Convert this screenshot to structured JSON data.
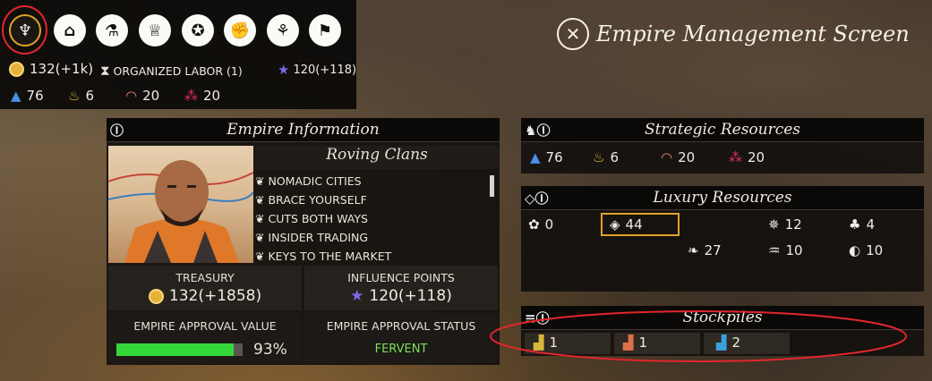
{
  "topbar": {
    "tabs": [
      {
        "name": "laurel-icon",
        "glyph": "♆",
        "active": true
      },
      {
        "name": "capitol-icon",
        "glyph": "⌂"
      },
      {
        "name": "flask-icon",
        "glyph": "⚗"
      },
      {
        "name": "trophy-icon",
        "glyph": "♕"
      },
      {
        "name": "medal-icon",
        "glyph": "✪"
      },
      {
        "name": "fist-icon",
        "glyph": "✊"
      },
      {
        "name": "handshake-icon",
        "glyph": "⚘"
      },
      {
        "name": "population-icon",
        "glyph": "⚑"
      }
    ],
    "money": "132(+1k)",
    "labor_label": "ORGANIZED LABOR (1)",
    "influence": "120(+118)",
    "resources": [
      {
        "icon": "water-drop-icon",
        "value": "76",
        "color": "#4a8ee8"
      },
      {
        "icon": "wheat-icon",
        "value": "6",
        "color": "#e0c040"
      },
      {
        "icon": "horn-icon",
        "value": "20",
        "color": "#ef8a6e"
      },
      {
        "icon": "berries-icon",
        "value": "20",
        "color": "#e03060"
      }
    ]
  },
  "screen_title": "Empire Management Screen",
  "empire_info": {
    "header": "Empire Information",
    "name": "Roving Clans",
    "traits": [
      "NOMADIC CITIES",
      "BRACE YOURSELF",
      "CUTS BOTH WAYS",
      "INSIDER TRADING",
      "KEYS TO THE MARKET"
    ],
    "treasury_label": "TREASURY",
    "treasury_value": "132(+1858)",
    "influence_label": "INFLUENCE POINTS",
    "influence_value": "120(+118)",
    "approval_label": "EMPIRE APPROVAL VALUE",
    "approval_value": "93%",
    "approval_fraction": 0.93,
    "status_label": "EMPIRE APPROVAL STATUS",
    "status_value": "FERVENT",
    "status_color": "#7be05a"
  },
  "strategic": {
    "header": "Strategic Resources",
    "items": [
      {
        "icon": "water-drop-icon",
        "value": "76",
        "color": "#4a8ee8"
      },
      {
        "icon": "wheat-icon",
        "value": "6",
        "color": "#e0c040"
      },
      {
        "icon": "horn-icon",
        "value": "20",
        "color": "#ef8a6e"
      },
      {
        "icon": "berries-icon",
        "value": "20",
        "color": "#e03060"
      }
    ]
  },
  "luxury": {
    "header": "Luxury Resources",
    "items": [
      {
        "icon": "flower-icon",
        "value": "0"
      },
      {
        "icon": "gem-icon",
        "value": "44",
        "highlighted": true
      },
      {
        "icon": "crystal-icon",
        "value": "12"
      },
      {
        "icon": "grapes-icon",
        "value": "4"
      },
      {
        "icon": "leaf-icon",
        "value": "27"
      },
      {
        "icon": "tusk-icon",
        "value": "10"
      },
      {
        "icon": "whale-icon",
        "value": "10"
      }
    ]
  },
  "stockpiles": {
    "header": "Stockpiles",
    "items": [
      {
        "icon": "stockpile-yellow-icon",
        "value": "1",
        "color": "#d8b83a"
      },
      {
        "icon": "stockpile-orange-icon",
        "value": "1",
        "color": "#e07048"
      },
      {
        "icon": "stockpile-blue-icon",
        "value": "2",
        "color": "#3aa0e0"
      }
    ]
  }
}
